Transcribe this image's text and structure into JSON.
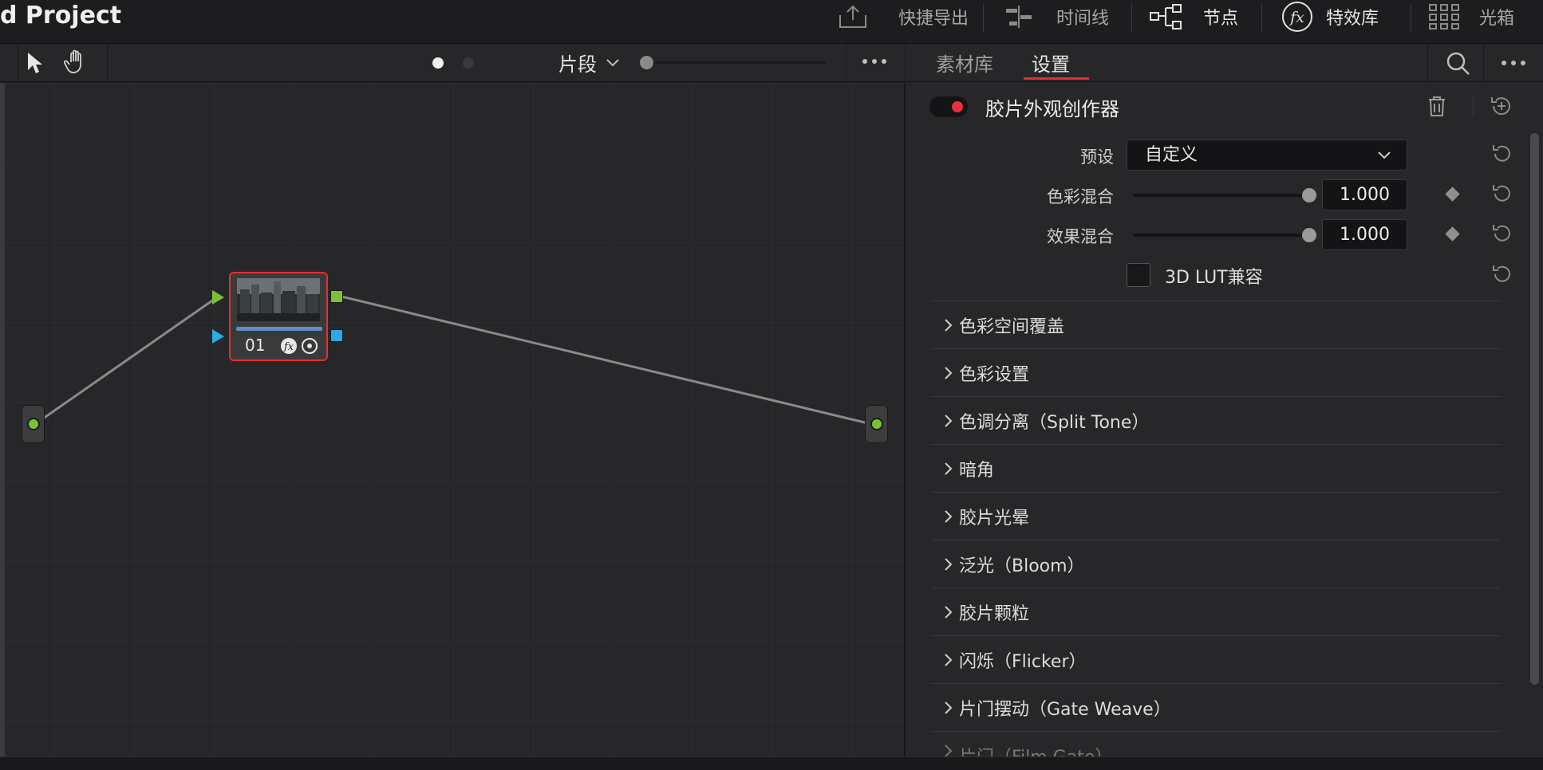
{
  "topbar": {
    "project_title": "d Project",
    "nav": [
      {
        "label": "快捷导出",
        "icon": "export-icon"
      },
      {
        "label": "时间线",
        "icon": "timeline-icon"
      },
      {
        "label": "节点",
        "icon": "nodes-icon"
      },
      {
        "label": "特效库",
        "icon": "fx-icon"
      },
      {
        "label": "光箱",
        "icon": "lightbox-icon"
      }
    ]
  },
  "node_toolbar": {
    "clip_mode": "片段",
    "page_dots": 2,
    "active_dot": 1
  },
  "node_graph": {
    "node": {
      "number": "01"
    }
  },
  "right_panel": {
    "tabs": [
      "素材库",
      "设置"
    ],
    "active_tab": "设置",
    "effect_title": "胶片外观创作器",
    "effect_enabled": true,
    "preset": {
      "label": "预设",
      "value": "自定义"
    },
    "color_mix": {
      "label": "色彩混合",
      "value": "1.000"
    },
    "effect_mix": {
      "label": "效果混合",
      "value": "1.000"
    },
    "lut_compat": {
      "label": "3D LUT兼容",
      "checked": false
    },
    "sections": [
      "色彩空间覆盖",
      "色彩设置",
      "色调分离（Split Tone）",
      "暗角",
      "胶片光晕",
      "泛光（Bloom）",
      "胶片颗粒",
      "闪烁（Flicker）",
      "片门摆动（Gate Weave）",
      "片门（Film Gate）"
    ]
  },
  "colors": {
    "accent_red": "#e4302c",
    "port_green": "#7ac234",
    "port_blue": "#2da8e8"
  }
}
